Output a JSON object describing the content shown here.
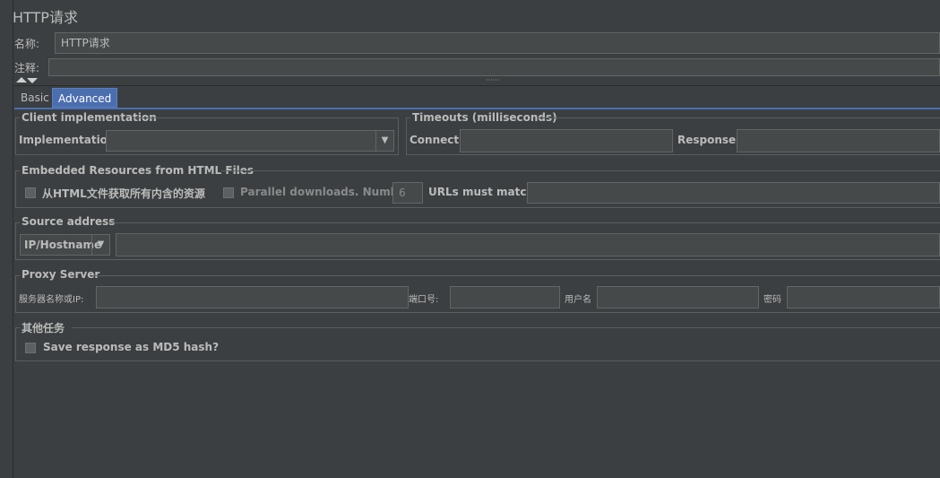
{
  "window": {
    "title": "HTTP请求"
  },
  "name_field": {
    "label": "名称:",
    "value": "HTTP请求"
  },
  "comment_field": {
    "label": "注释:",
    "value": ""
  },
  "tabs": [
    {
      "label": "Basic",
      "active": false
    },
    {
      "label": "Advanced",
      "active": true
    }
  ],
  "client_impl": {
    "title": "Client implementation",
    "impl_label": "Implementation:",
    "impl_value": ""
  },
  "timeouts": {
    "title": "Timeouts (milliseconds)",
    "connect_label": "Connect:",
    "connect_value": "",
    "response_label": "Response:",
    "response_value": ""
  },
  "embedded": {
    "title": "Embedded Resources from HTML Files",
    "retrieve_label": "从HTML文件获取所有内含的资源",
    "parallel_label": "Parallel downloads. Number:",
    "parallel_value": "6",
    "urls_label": "URLs must match:",
    "urls_value": ""
  },
  "source": {
    "title": "Source address",
    "type_value": "IP/Hostname",
    "address_value": ""
  },
  "proxy": {
    "title": "Proxy Server",
    "server_label": "服务器名称或IP:",
    "port_label": "端口号:",
    "user_label": "用户名",
    "password_label": "密码"
  },
  "other": {
    "title": "其他任务",
    "md5_label": "Save response as MD5 hash?"
  }
}
